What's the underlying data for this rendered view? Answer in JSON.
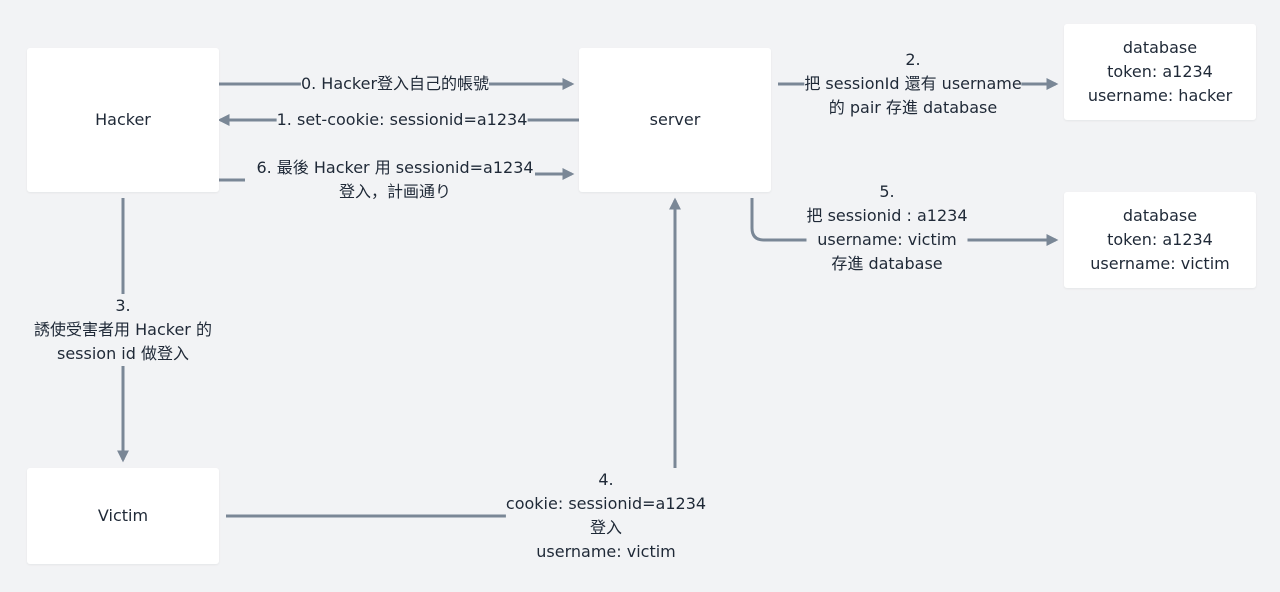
{
  "colors": {
    "background": "#f2f3f5",
    "node_fill": "#ffffff",
    "edge": "#7a8796",
    "text": "#1f2937"
  },
  "nodes": {
    "hacker": "Hacker",
    "server": "server",
    "victim": "Victim",
    "db_hacker": [
      "database",
      "token: a1234",
      "username: hacker"
    ],
    "db_victim": [
      "database",
      "token: a1234",
      "username: victim"
    ]
  },
  "edges": {
    "step0": [
      "0. Hacker登入自己的帳號"
    ],
    "step1": [
      "1. set-cookie: sessionid=a1234"
    ],
    "step6": [
      "6. 最後 Hacker 用 sessionid=a1234",
      "登入，計画通り"
    ],
    "step2": [
      "2.",
      "把 sessionId 還有  username",
      "的 pair 存進 database"
    ],
    "step5": [
      "5.",
      "把 sessionid : a1234",
      "username: victim",
      "存進 database"
    ],
    "step3": [
      "3.",
      "誘使受害者用 Hacker 的",
      "session id  做登入"
    ],
    "step4": [
      "4.",
      "cookie: sessionid=a1234",
      "登入",
      "username: victim"
    ]
  }
}
